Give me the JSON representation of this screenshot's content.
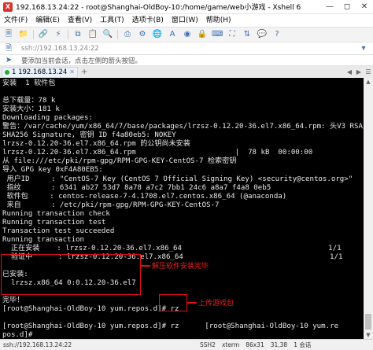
{
  "window": {
    "title": "192.168.13.24:22 - root@Shanghai-OldBoy-10:/home/game/web小游戏 - Xshell 6"
  },
  "menu": [
    "文件(F)",
    "编辑(E)",
    "查看(V)",
    "工具(T)",
    "选项卡(B)",
    "窗口(W)",
    "帮助(H)"
  ],
  "address": {
    "text": "ssh://192.168.13.24:22"
  },
  "session_hint": "要添加当前会话，点击左侧的箭头按钮。",
  "tab": {
    "label": "1 192.168.13.24"
  },
  "terminal_lines": [
    "安装  1 软件包",
    "",
    "总下载量：78 k",
    "安装大小：181 k",
    "Downloading packages:",
    "警告：/var/cache/yum/x86_64/7/base/packages/lrzsz-0.12.20-36.el7.x86_64.rpm: 头V3 RSA/",
    "SHA256 Signature, 密钥 ID f4a80eb5: NOKEY",
    "lrzsz-0.12.20-36.el7.x86_64.rpm 的公钥尚未安装",
    "lrzsz-0.12.20-36.el7.x86_64.rpm                       |  78 kB  00:00:00",
    "从 file:///etc/pki/rpm-gpg/RPM-GPG-KEY-CentOS-7 检索密钥",
    "导入 GPG key 0xF4A80EB5:",
    " 用户ID     : \"CentOS-7 Key (CentOS 7 Official Signing Key) <security@centos.org>\"",
    " 指纹       : 6341 ab27 53d7 8a78 a7c2 7bb1 24c6 a8a7 f4a8 0eb5",
    " 软件包     : centos-release-7-4.1708.el7.centos.x86_64 (@anaconda)",
    " 来自       : /etc/pki/rpm-gpg/RPM-GPG-KEY-CentOS-7",
    "Running transaction check",
    "Running transaction test",
    "Transaction test succeeded",
    "Running transaction",
    "  正在安装    : lrzsz-0.12.20-36.el7.x86_64                                  1/1",
    "  验证中      : lrzsz-0.12.20-36.el7.x86_64                                  1/1",
    "",
    "已安装:",
    "  lrzsz.x86_64 0:0.12.20-36.el7",
    "",
    "完毕！",
    "[root@Shanghai-OldBoy-10 yum.repos.d]# rz",
    "",
    "[root@Shanghai-OldBoy-10 yum.repos.d]# rz      [root@Shanghai-OldBoy-10 yum.re",
    "pos.d]# ",
    ""
  ],
  "annotations": {
    "installed_note": "解压软件安装完毕",
    "upload_note": "上传游戏包"
  },
  "status": {
    "host": "ssh://192.168.13.24:22",
    "protocol": "SSH2",
    "terminal": "xterm",
    "size": "86x31",
    "cursor": "31,38",
    "sessions": "1 会话"
  },
  "colors": {
    "annotation": "#e01010",
    "terminal_bg": "#000000",
    "terminal_fg": "#e8e8e8"
  }
}
